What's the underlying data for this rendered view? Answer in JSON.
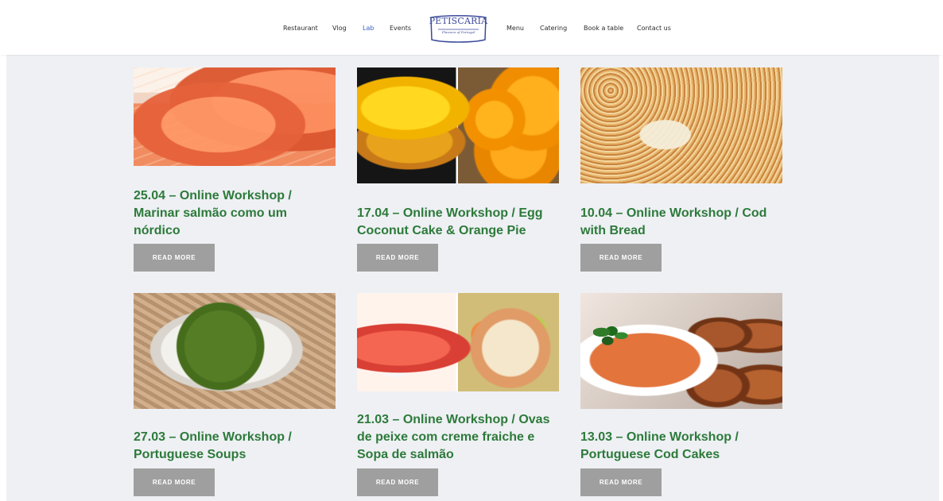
{
  "nav": {
    "left": [
      "Restaurant",
      "Vlog",
      "Lab",
      "Events"
    ],
    "right": [
      "Menu",
      "Catering",
      "Book a table",
      "Contact us"
    ],
    "active": "Lab"
  },
  "logo": {
    "title": "PETISCARIA",
    "subtitle": "Flavours of Portugal"
  },
  "colors": {
    "background": "#eef0f4",
    "title_green": "#2d7a3a",
    "button_gray": "#9f9f9f",
    "active_blue": "#3d63c9"
  },
  "posts": [
    {
      "title": "25.04 – Online Workshop / Marinar salmão como um nórdico",
      "button": "READ MORE",
      "image": "salmon-image"
    },
    {
      "title": "17.04 – Online Workshop / Egg Coconut Cake & Orange Pie",
      "button": "READ MORE",
      "image": "egg-coconut-cake-orange-pie-image"
    },
    {
      "title": "10.04 – Online Workshop / Cod with Bread",
      "button": "READ MORE",
      "image": "cod-with-bread-image"
    },
    {
      "title": "27.03 – Online Workshop / Portuguese Soups",
      "button": "READ MORE",
      "image": "portuguese-soup-image"
    },
    {
      "title": "21.03 – Online Workshop / Ovas de peixe com creme fraiche e Sopa de salmão",
      "button": "READ MORE",
      "image": "fish-roe-and-salmon-soup-image"
    },
    {
      "title": "13.03 – Online Workshop / Portuguese Cod Cakes",
      "button": "READ MORE",
      "image": "portuguese-cod-cakes-image"
    }
  ]
}
